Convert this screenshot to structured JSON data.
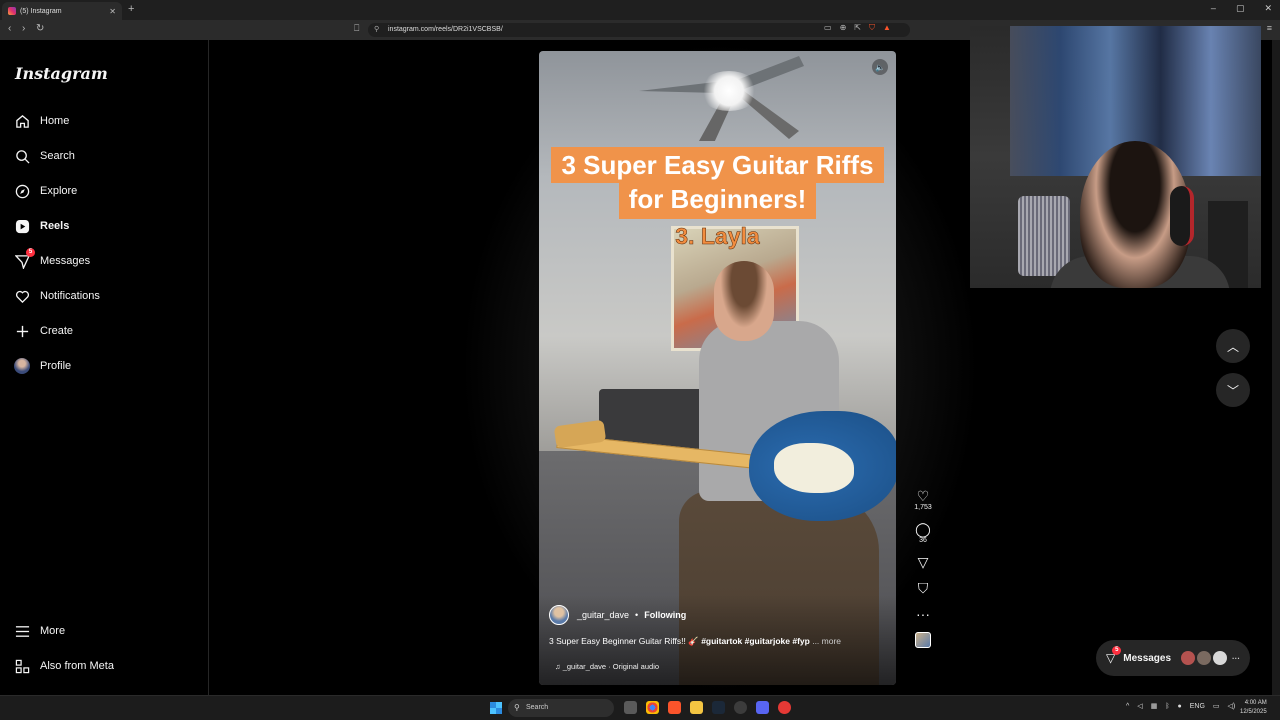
{
  "browser": {
    "tab_title": "(5) Instagram",
    "url": "instagram.com/reels/DR2i1VSCBSB/"
  },
  "sidebar": {
    "logo": "Instagram",
    "items": [
      {
        "label": "Home",
        "icon": "home-icon"
      },
      {
        "label": "Search",
        "icon": "search-icon"
      },
      {
        "label": "Explore",
        "icon": "compass-icon"
      },
      {
        "label": "Reels",
        "icon": "reels-icon",
        "active": true
      },
      {
        "label": "Messages",
        "icon": "messenger-icon",
        "badge": "5"
      },
      {
        "label": "Notifications",
        "icon": "heart-icon"
      },
      {
        "label": "Create",
        "icon": "plus-icon"
      },
      {
        "label": "Profile",
        "icon": "avatar"
      }
    ],
    "bottom_items": [
      {
        "label": "More",
        "icon": "hamburger-icon"
      },
      {
        "label": "Also from Meta",
        "icon": "meta-icon"
      }
    ]
  },
  "reel": {
    "title_line1": "3 Super Easy Guitar Riffs",
    "title_line2": "for Beginners!",
    "subtitle": "3. Layla",
    "author": "_guitar_dave",
    "follow_label": "Following",
    "caption_text": "3 Super Easy Beginner Guitar Riffs!! 🎸",
    "caption_tags": "#guitartok #guitarjoke #fyp",
    "caption_more": "... more",
    "audio": "_guitar_dave · Original audio"
  },
  "actions": {
    "likes": "1,753",
    "comments": "36"
  },
  "messages_pill": {
    "label": "Messages",
    "badge": "5"
  },
  "taskbar": {
    "search_label": "Search",
    "lang": "ENG",
    "time": "4:00 AM",
    "date": "12/5/2025"
  }
}
